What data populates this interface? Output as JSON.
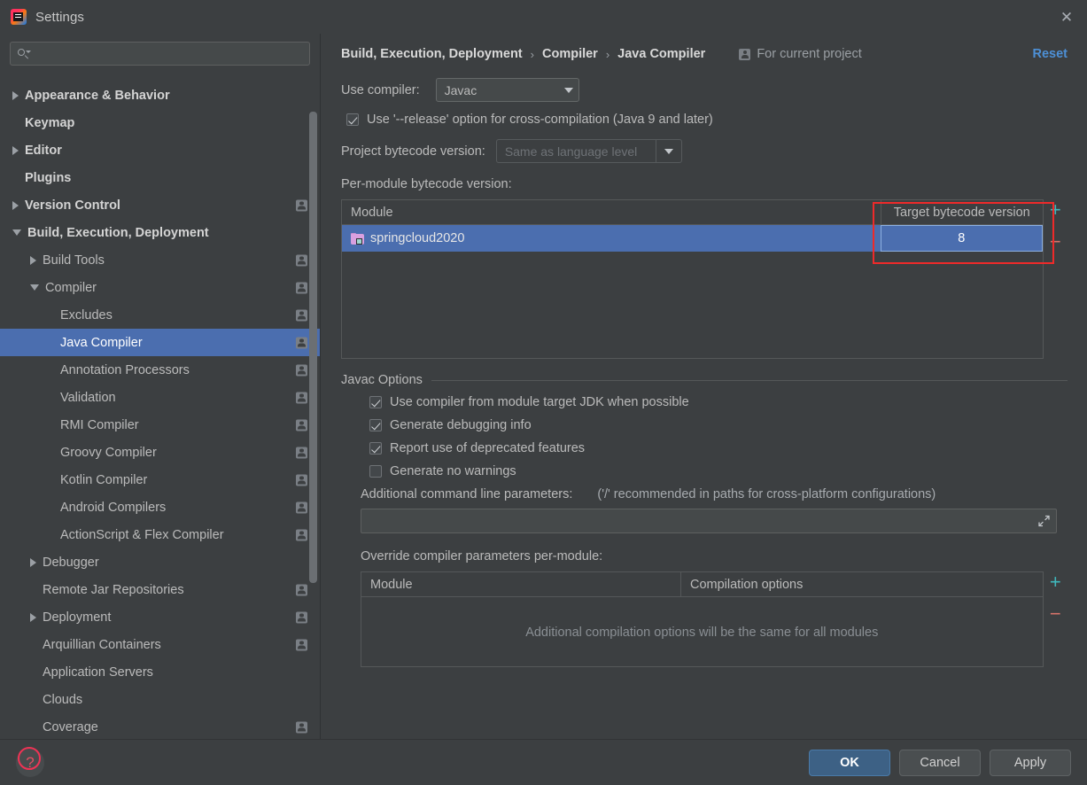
{
  "window": {
    "title": "Settings",
    "logo_name": "intellij-idea-logo",
    "close_label": "✕"
  },
  "search": {
    "value": "",
    "placeholder": ""
  },
  "sidebar": {
    "items": [
      {
        "label": "Appearance & Behavior",
        "indent": 0,
        "twisty": "right",
        "bold": true,
        "badge": false,
        "selected": false
      },
      {
        "label": "Keymap",
        "indent": 0,
        "twisty": "none",
        "bold": true,
        "badge": false,
        "selected": false
      },
      {
        "label": "Editor",
        "indent": 0,
        "twisty": "right",
        "bold": true,
        "badge": false,
        "selected": false
      },
      {
        "label": "Plugins",
        "indent": 0,
        "twisty": "none",
        "bold": true,
        "badge": false,
        "selected": false
      },
      {
        "label": "Version Control",
        "indent": 0,
        "twisty": "right",
        "bold": true,
        "badge": true,
        "selected": false
      },
      {
        "label": "Build, Execution, Deployment",
        "indent": 0,
        "twisty": "down",
        "bold": true,
        "badge": false,
        "selected": false
      },
      {
        "label": "Build Tools",
        "indent": 1,
        "twisty": "right",
        "bold": false,
        "badge": true,
        "selected": false
      },
      {
        "label": "Compiler",
        "indent": 1,
        "twisty": "down",
        "bold": false,
        "badge": true,
        "selected": false
      },
      {
        "label": "Excludes",
        "indent": 2,
        "twisty": "none",
        "bold": false,
        "badge": true,
        "selected": false
      },
      {
        "label": "Java Compiler",
        "indent": 2,
        "twisty": "none",
        "bold": false,
        "badge": true,
        "selected": true
      },
      {
        "label": "Annotation Processors",
        "indent": 2,
        "twisty": "none",
        "bold": false,
        "badge": true,
        "selected": false
      },
      {
        "label": "Validation",
        "indent": 2,
        "twisty": "none",
        "bold": false,
        "badge": true,
        "selected": false
      },
      {
        "label": "RMI Compiler",
        "indent": 2,
        "twisty": "none",
        "bold": false,
        "badge": true,
        "selected": false
      },
      {
        "label": "Groovy Compiler",
        "indent": 2,
        "twisty": "none",
        "bold": false,
        "badge": true,
        "selected": false
      },
      {
        "label": "Kotlin Compiler",
        "indent": 2,
        "twisty": "none",
        "bold": false,
        "badge": true,
        "selected": false
      },
      {
        "label": "Android Compilers",
        "indent": 2,
        "twisty": "none",
        "bold": false,
        "badge": true,
        "selected": false
      },
      {
        "label": "ActionScript & Flex Compiler",
        "indent": 2,
        "twisty": "none",
        "bold": false,
        "badge": true,
        "selected": false
      },
      {
        "label": "Debugger",
        "indent": 1,
        "twisty": "right",
        "bold": false,
        "badge": false,
        "selected": false
      },
      {
        "label": "Remote Jar Repositories",
        "indent": 1,
        "twisty": "none",
        "bold": false,
        "badge": true,
        "selected": false
      },
      {
        "label": "Deployment",
        "indent": 1,
        "twisty": "right",
        "bold": false,
        "badge": true,
        "selected": false
      },
      {
        "label": "Arquillian Containers",
        "indent": 1,
        "twisty": "none",
        "bold": false,
        "badge": true,
        "selected": false
      },
      {
        "label": "Application Servers",
        "indent": 1,
        "twisty": "none",
        "bold": false,
        "badge": false,
        "selected": false
      },
      {
        "label": "Clouds",
        "indent": 1,
        "twisty": "none",
        "bold": false,
        "badge": false,
        "selected": false
      },
      {
        "label": "Coverage",
        "indent": 1,
        "twisty": "none",
        "bold": false,
        "badge": true,
        "selected": false
      }
    ]
  },
  "header": {
    "breadcrumbs": [
      "Build, Execution, Deployment",
      "Compiler",
      "Java Compiler"
    ],
    "separator": "›",
    "scope_label": "For current project",
    "scope_icon": "project-scope-icon",
    "reset_label": "Reset"
  },
  "compiler": {
    "use_compiler_label": "Use compiler:",
    "use_compiler_value": "Javac",
    "release_option_label": "Use '--release' option for cross-compilation (Java 9 and later)",
    "release_option_checked": true,
    "project_bytecode_label": "Project bytecode version:",
    "project_bytecode_value": "Same as language level",
    "project_bytecode_disabled": true,
    "per_module_label": "Per-module bytecode version:"
  },
  "module_table": {
    "columns": [
      "Module",
      "Target bytecode version"
    ],
    "rows": [
      {
        "module": "springcloud2020",
        "target": "8",
        "selected": true,
        "editing": true
      }
    ],
    "add_label": "+",
    "remove_label": "−"
  },
  "javac_options": {
    "group_title": "Javac Options",
    "checkboxes": [
      {
        "label": "Use compiler from module target JDK when possible",
        "checked": true
      },
      {
        "label": "Generate debugging info",
        "checked": true
      },
      {
        "label": "Report use of deprecated features",
        "checked": true
      },
      {
        "label": "Generate no warnings",
        "checked": false
      }
    ],
    "additional_params_label": "Additional command line parameters:",
    "additional_params_hint": "('/' recommended in paths for cross-platform configurations)",
    "additional_params_value": "",
    "expand_icon": "expand-editor-icon"
  },
  "override_table": {
    "section_label": "Override compiler parameters per-module:",
    "columns": [
      "Module",
      "Compilation options"
    ],
    "empty_message": "Additional compilation options will be the same for all modules",
    "add_label": "+",
    "remove_label": "−"
  },
  "footer": {
    "help_label": "?",
    "ok_label": "OK",
    "cancel_label": "Cancel",
    "apply_label": "Apply"
  },
  "colors": {
    "background": "#3c3f41",
    "selection": "#4b6eaf",
    "link": "#4d90d6",
    "annotation": "#ee2a2a",
    "add_button": "#3fb8bd",
    "remove_button": "#d9736a",
    "help_icon": "#e04f62"
  }
}
